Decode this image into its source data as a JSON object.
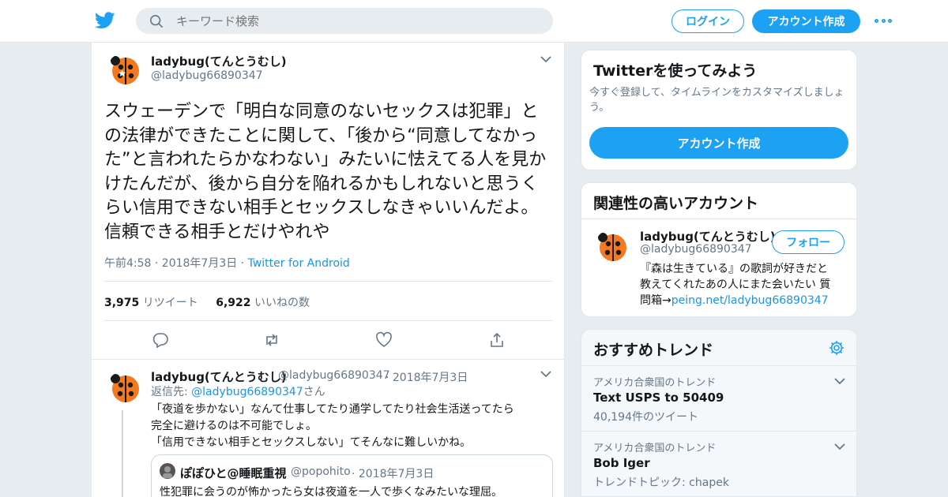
{
  "header": {
    "search_placeholder": "キーワード検索",
    "login_label": "ログイン",
    "signup_label": "アカウント作成"
  },
  "tweet": {
    "name": "ladybug(てんとうむし)",
    "handle": "@ladybug66890347",
    "text": "スウェーデンで「明白な同意のないセックスは犯罪」との法律ができたことに関して、「後から“同意してなかった”と言われたらかなわない」みたいに怯えてる人を見かけたんだが、後から自分を陥れるかもしれないと思うくらい信用できない相手とセックスしなきゃいいんだよ。信頼できる相手とだけやれや",
    "time": "午前4:58 · 2018年7月3日",
    "source_sep": " · ",
    "source": "Twitter for Android",
    "retweets": "3,975",
    "retweets_label": "リツイート",
    "likes": "6,922",
    "likes_label": "いいねの数"
  },
  "reply": {
    "name": "ladybug(てんとうむし)",
    "handle": "@ladybug66890347",
    "date": "· 2018年7月3日",
    "reply_to_prefix": "返信先: ",
    "reply_to_handle": "@ladybug66890347",
    "reply_to_suffix": "さん",
    "line1": "「夜道を歩かない」なんて仕事してたり通学してたり社会生活送ってたら",
    "line2": "完全に避けるのは不可能でしょ。",
    "line3": "「信用できない相手とセックスしない」てそんなに難しいかね。",
    "quote_name": "ぽぽひと@睡眠重視",
    "quote_handle": "@popohito",
    "quote_date": "· 2018年7月3日",
    "quote_text": "性犯罪に会うのが怖かったら女は夜道を一人で歩くなみたいな理屈。"
  },
  "sidebar": {
    "try": {
      "title": "Twitterを使ってみよう",
      "subtitle_line1": "今すぐ登録して、タイムラインをカスタマイズしましょ",
      "subtitle_line2": "う。",
      "cta": "アカウント作成"
    },
    "related": {
      "title": "関連性の高いアカウント",
      "name": "ladybug(てんとうむし)",
      "handle": "@ladybug66890347",
      "follow": "フォロー",
      "bio_line1": "『森は生きている』の歌詞が好きだと",
      "bio_line2": "教えてくれたあの人にまた会いたい 質",
      "bio_line3_prefix": "問箱→",
      "bio_link": "peing.net/ladybug66890347"
    },
    "trends": {
      "title": "おすすめトレンド",
      "items": [
        {
          "category": "アメリカ合衆国のトレンド",
          "name": "Text USPS to 50409",
          "meta": "40,194件のツイート"
        },
        {
          "category": "アメリカ合衆国のトレンド",
          "name": "Bob Iger",
          "meta": "トレンドトピック: chapek"
        }
      ]
    }
  },
  "colors": {
    "brand": "#1da1f2",
    "link": "#1b95e0",
    "muted": "#657786",
    "avatar_orange": "#f47920"
  }
}
